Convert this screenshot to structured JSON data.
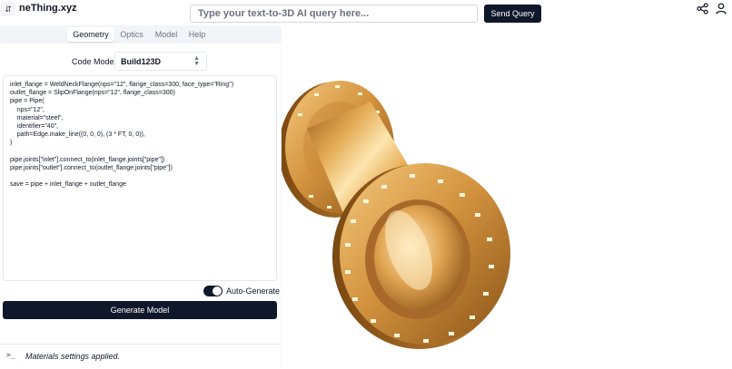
{
  "app": {
    "title": "neThing.xyz",
    "toggle_icon": "chevron-updown-icon"
  },
  "search": {
    "placeholder": "Type your text-to-3D AI query here...",
    "value": ""
  },
  "send": {
    "label": "Send Query"
  },
  "header_icons": [
    "share-icon",
    "user-icon"
  ],
  "tabs": [
    {
      "label": "Geometry",
      "active": true
    },
    {
      "label": "Optics",
      "active": false
    },
    {
      "label": "Model",
      "active": false
    },
    {
      "label": "Help",
      "active": false
    }
  ],
  "code_mode": {
    "label": "Code Mode:",
    "value": "Build123D"
  },
  "code": {
    "lines": [
      "inlet_flange = WeldNeckFlange(nps=\"12\", flange_class=300, face_type=\"Ring\")",
      "outlet_flange = SlipOnFlange(nps=\"12\", flange_class=300)",
      "pipe = Pipe(",
      "    nps=\"12\",",
      "    material=\"steel\",",
      "    identifier=\"40\",",
      "    path=Edge.make_line((0, 0, 0), (3 * FT, 0, 0)),",
      ")",
      "",
      "pipe.joints[\"inlet\"].connect_to(inlet_flange.joints[\"pipe\"])",
      "pipe.joints[\"outlet\"].connect_to(outlet_flange.joints[\"pipe\"])",
      "",
      "save = pipe + inlet_flange + outlet_flange"
    ]
  },
  "auto_generate": {
    "label": "Auto-Generate",
    "enabled": true
  },
  "generate": {
    "label": "Generate Model"
  },
  "console": {
    "icon": "terminal-icon",
    "message": "Materials settings applied."
  },
  "colors": {
    "accent": "#0f172a",
    "copper_light": "#f5d08a",
    "copper_mid": "#d4943f",
    "copper_dark": "#8a5418"
  }
}
